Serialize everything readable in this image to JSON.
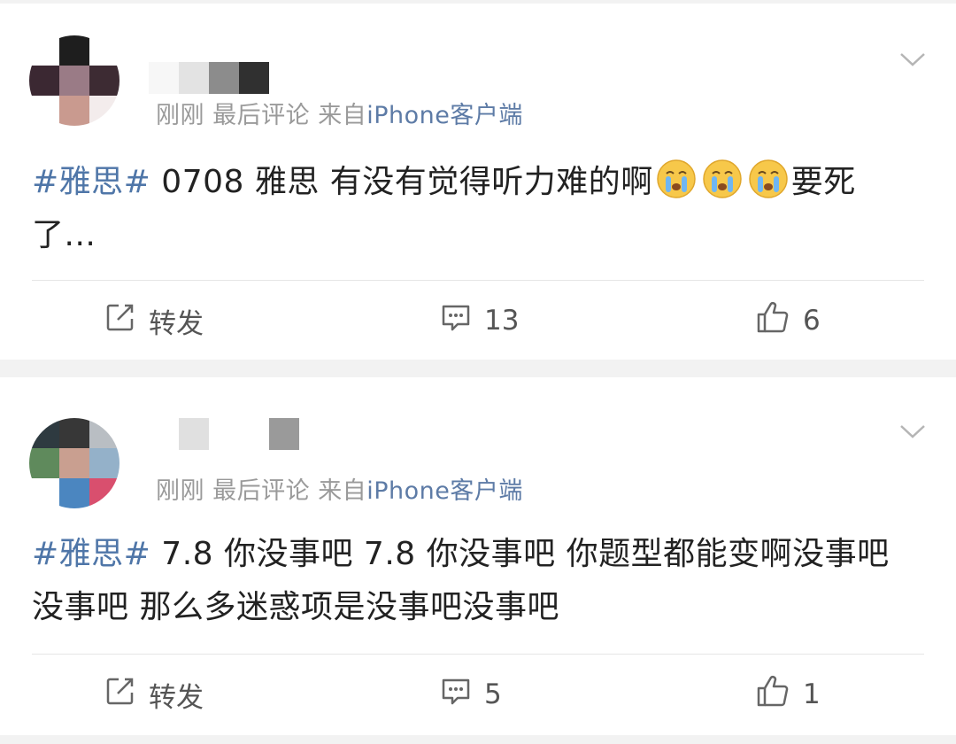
{
  "posts": [
    {
      "meta": {
        "time": "刚刚",
        "action": "最后评论",
        "source_prefix": "来自",
        "source": "iPhone客户端"
      },
      "content": {
        "hashtag": "#雅思#",
        "text_before_emoji": " 0708 雅思 有没有觉得听力难的啊",
        "emojis": [
          "crying-face",
          "crying-face",
          "crying-face"
        ],
        "text_after_emoji": "要死了..."
      },
      "actions": {
        "repost": "转发",
        "comments": "13",
        "likes": "6"
      }
    },
    {
      "meta": {
        "time": "刚刚",
        "action": "最后评论",
        "source_prefix": "来自",
        "source": "iPhone客户端"
      },
      "content": {
        "hashtag": "#雅思#",
        "text": " 7.8 你没事吧 7.8 你没事吧 你题型都能变啊没事吧没事吧 那么多迷惑项是没事吧没事吧"
      },
      "actions": {
        "repost": "转发",
        "comments": "5",
        "likes": "1"
      }
    }
  ],
  "icons": {
    "repost": "edit-share-icon",
    "comment": "comment-bubble-icon",
    "like": "thumbs-up-icon",
    "menu": "chevron-down-icon"
  },
  "colors": {
    "hashtag": "#4f76a8",
    "source_link": "#5d7ba6",
    "meta": "#9a9a9a"
  }
}
